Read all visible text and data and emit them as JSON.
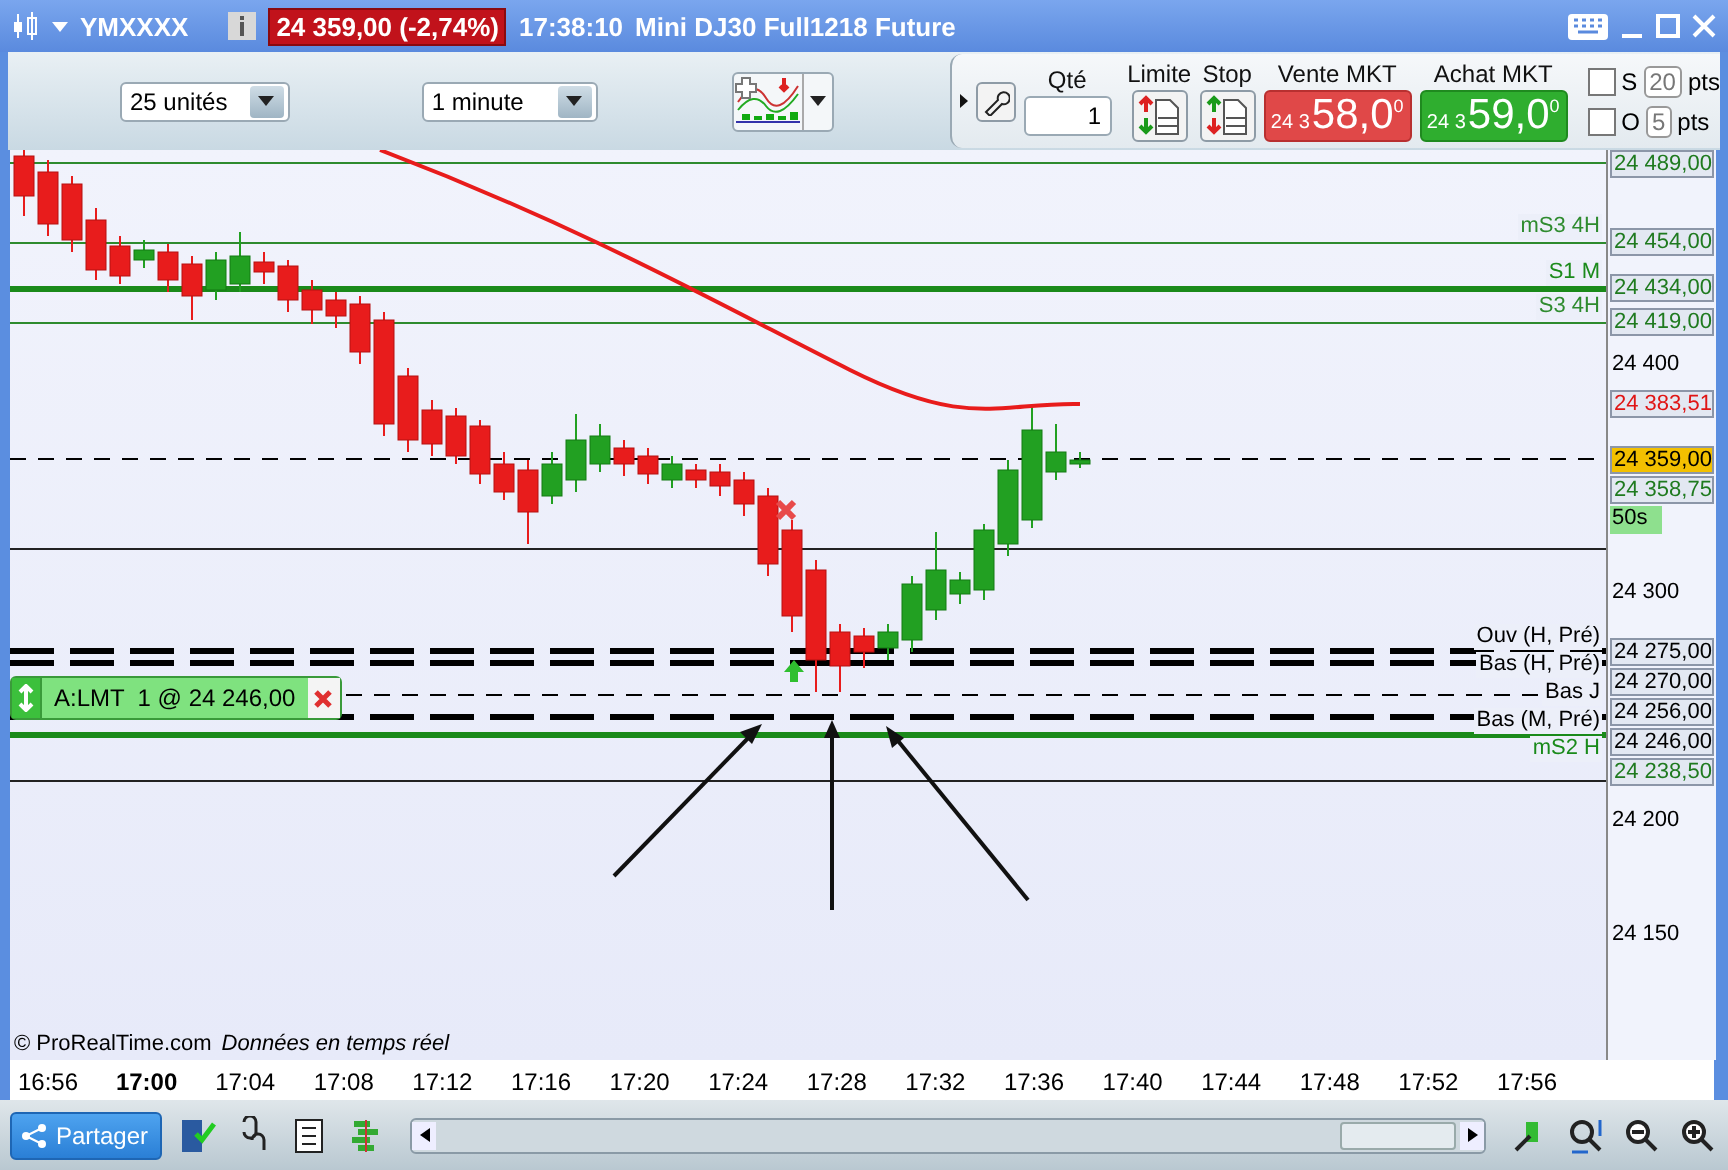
{
  "window": {
    "symbol": "YMXXXX",
    "price_badge": "24 359,00 (-2,74%)",
    "time": "17:38:10",
    "title": "Mini DJ30 Full1218 Future"
  },
  "toolbar": {
    "units_select": "25 unités",
    "interval_select": "1 minute"
  },
  "order_panel": {
    "qty_label": "Qté",
    "qty_value": "1",
    "limit_label": "Limite",
    "stop_label": "Stop",
    "sell": {
      "label": "Vente MKT",
      "prefix": "24 3",
      "main": "58,0",
      "sup": "0"
    },
    "buy": {
      "label": "Achat MKT",
      "prefix": "24 3",
      "main": "59,0",
      "sup": "0"
    },
    "options": [
      {
        "label": "S",
        "checked": false,
        "value": "20",
        "unit": "pts"
      },
      {
        "label": "O",
        "checked": false,
        "value": "5",
        "unit": "pts"
      }
    ]
  },
  "chart": {
    "axis": [
      {
        "text": "24 489,00",
        "kind": "level",
        "dashed": false,
        "thick": false,
        "color": "#2e8b2e"
      },
      {
        "text": "24 454,00",
        "kind": "level",
        "dashed": false,
        "thick": false,
        "color": "#2e8b2e",
        "line_label": "mS3 4H"
      },
      {
        "text": "24 434,00",
        "kind": "level",
        "dashed": false,
        "thick": true,
        "color": "#1a8a1a",
        "line_label": "S1 M"
      },
      {
        "text": "24 419,00",
        "kind": "level",
        "dashed": false,
        "thick": false,
        "color": "#2e8b2e",
        "line_label": "S3 4H"
      },
      {
        "text": "24 400",
        "kind": "tick"
      },
      {
        "text": "24 383,51",
        "kind": "ma"
      },
      {
        "text": "24 359,00",
        "kind": "last",
        "dashed": true,
        "thick": false,
        "color": "#000000"
      },
      {
        "text": "24 358,75",
        "kind": "level"
      },
      {
        "text": "50s",
        "kind": "timer"
      },
      {
        "text": "24 300",
        "kind": "tick"
      },
      {
        "text": "24 275,00",
        "kind": "level",
        "dashed": true,
        "thick": true,
        "color": "#000000",
        "line_label": "Ouv (H, Pré)"
      },
      {
        "text": "24 270,00",
        "kind": "level",
        "dashed": true,
        "thick": true,
        "color": "#000000",
        "line_label": "Bas (H, Pré)"
      },
      {
        "text": "24 256,00",
        "kind": "level",
        "dashed": true,
        "thick": false,
        "color": "#000000",
        "line_label": "Bas J"
      },
      {
        "text": "24 246,00",
        "kind": "level",
        "dashed": true,
        "thick": true,
        "color": "#000000",
        "line_label": "Bas (M, Pré)"
      },
      {
        "text": "24 238,50",
        "kind": "level",
        "dashed": false,
        "thick": true,
        "color": "#1a8a1a",
        "line_label": "mS2 H"
      },
      {
        "text": "24 200",
        "kind": "tick"
      },
      {
        "text": "24 150",
        "kind": "tick"
      }
    ],
    "order": {
      "label": "A:LMT  1 @ 24 246,00"
    },
    "credit": {
      "source": "© ProRealTime.com",
      "note": "Données en temps réel"
    },
    "times": [
      {
        "text": "16:56",
        "major": false
      },
      {
        "text": "17:00",
        "major": true
      },
      {
        "text": "17:04",
        "major": false
      },
      {
        "text": "17:08",
        "major": false
      },
      {
        "text": "17:12",
        "major": false
      },
      {
        "text": "17:16",
        "major": false
      },
      {
        "text": "17:20",
        "major": false
      },
      {
        "text": "17:24",
        "major": false
      },
      {
        "text": "17:28",
        "major": false
      },
      {
        "text": "17:32",
        "major": false
      },
      {
        "text": "17:36",
        "major": false
      },
      {
        "text": "17:40",
        "major": false
      },
      {
        "text": "17:44",
        "major": false
      },
      {
        "text": "17:48",
        "major": false
      },
      {
        "text": "17:52",
        "major": false
      },
      {
        "text": "17:56",
        "major": false
      }
    ]
  },
  "bottom_bar": {
    "share_button": "Partager"
  }
}
